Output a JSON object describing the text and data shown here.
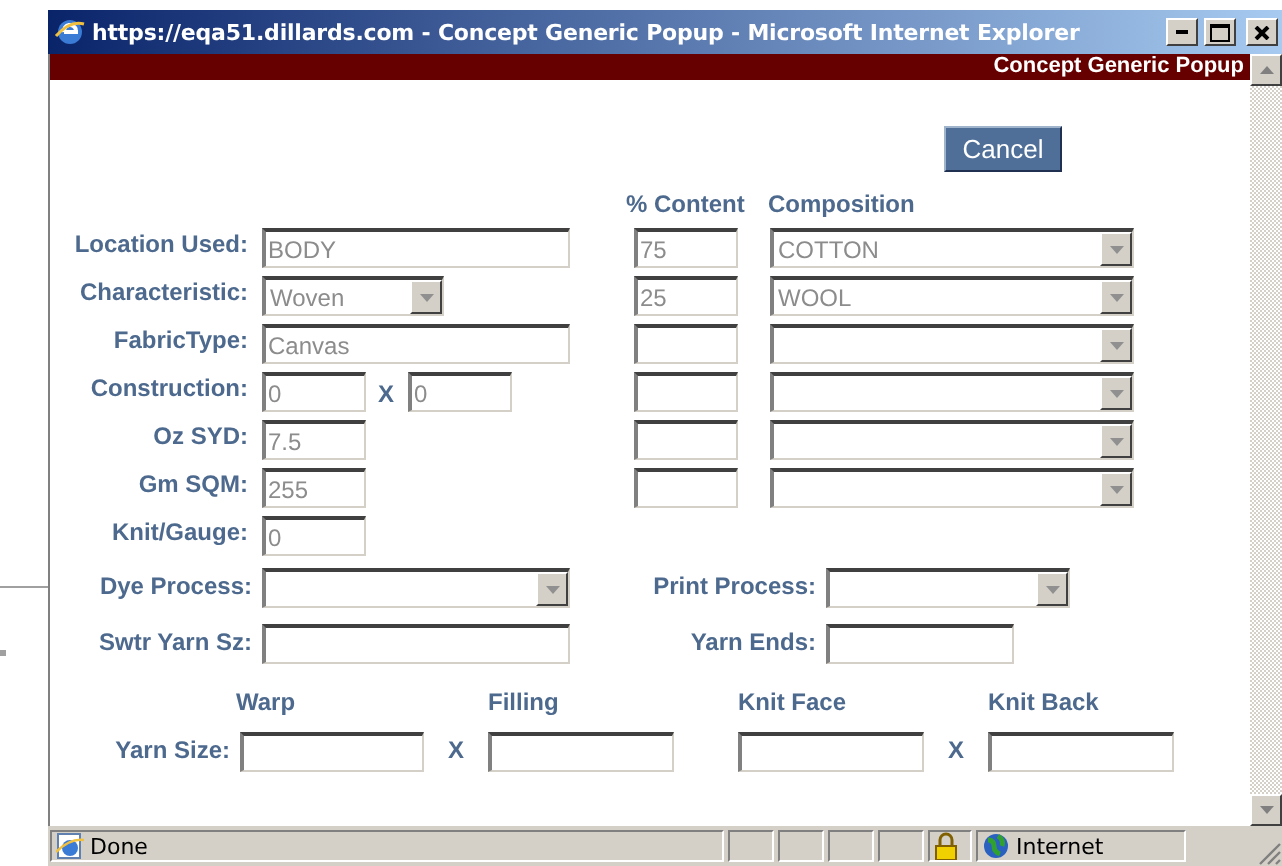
{
  "window": {
    "title": "https://eqa51.dillards.com - Concept Generic Popup - Microsoft Internet Explorer"
  },
  "header": {
    "title": "Concept Generic Popup"
  },
  "cancel_button": {
    "label": "Cancel"
  },
  "fields": [
    {
      "label": "Location Used:",
      "kind": "text",
      "value": "BODY"
    },
    {
      "label": "Characteristic:",
      "kind": "select",
      "value": "Woven"
    },
    {
      "label": "FabricType:",
      "kind": "text",
      "value": "Canvas"
    },
    {
      "label": "Construction:",
      "kind": "pair",
      "value": "0",
      "separator": "X",
      "value_2": "0"
    },
    {
      "label": "Oz SYD:",
      "kind": "short",
      "value": "7.5"
    },
    {
      "label": "Gm SQM:",
      "kind": "short",
      "value": "255"
    },
    {
      "label": "Knit/Gauge:",
      "kind": "short",
      "value": "0"
    }
  ],
  "composition": {
    "columns": [
      "% Content",
      "Composition"
    ],
    "rows": [
      {
        "content": "75",
        "composition": "COTTON"
      },
      {
        "content": "25",
        "composition": "WOOL"
      },
      {},
      {},
      {},
      {}
    ]
  },
  "process": [
    {
      "label": "Dye Process:",
      "kind": "select"
    },
    {
      "label": "Print Process:",
      "kind": "select"
    },
    {
      "label": "Swtr Yarn Sz:",
      "kind": "text"
    },
    {
      "label": "Yarn Ends:",
      "kind": "short"
    }
  ],
  "yarn_size": {
    "label": "Yarn Size:",
    "columns": [
      "Warp",
      "Filling",
      "Knit Face",
      "Knit Back"
    ],
    "separators": [
      "X",
      "X"
    ]
  },
  "status_bar": {
    "text": "Done",
    "zone": "Internet"
  }
}
